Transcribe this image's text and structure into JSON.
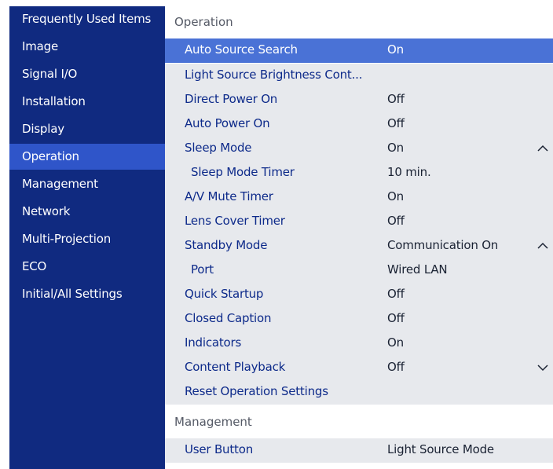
{
  "sidebar": {
    "items": [
      {
        "label": "Frequently Used Items"
      },
      {
        "label": "Image"
      },
      {
        "label": "Signal I/O"
      },
      {
        "label": "Installation"
      },
      {
        "label": "Display"
      },
      {
        "label": "Operation",
        "active": true
      },
      {
        "label": "Management"
      },
      {
        "label": "Network"
      },
      {
        "label": "Multi-Projection"
      },
      {
        "label": "ECO"
      },
      {
        "label": "Initial/All Settings"
      }
    ]
  },
  "main": {
    "section_operation": "Operation",
    "section_management": "Management",
    "rows": [
      {
        "label": "Auto Source Search",
        "value": "On",
        "selected": true
      },
      {
        "label": "Light Source Brightness Cont...",
        "value": ""
      },
      {
        "label": "Direct Power On",
        "value": "Off"
      },
      {
        "label": "Auto Power On",
        "value": "Off"
      },
      {
        "label": "Sleep Mode",
        "value": "On",
        "chevron": "chevron-up-icon"
      },
      {
        "label": "Sleep Mode Timer",
        "value": "10 min.",
        "sub": true
      },
      {
        "label": "A/V Mute Timer",
        "value": "On"
      },
      {
        "label": "Lens Cover Timer",
        "value": "Off"
      },
      {
        "label": "Standby Mode",
        "value": "Communication On",
        "chevron": "chevron-up-icon"
      },
      {
        "label": "Port",
        "value": "Wired LAN",
        "sub": true
      },
      {
        "label": "Quick Startup",
        "value": "Off"
      },
      {
        "label": "Closed Caption",
        "value": "Off"
      },
      {
        "label": "Indicators",
        "value": "On"
      },
      {
        "label": "Content Playback",
        "value": "Off",
        "chevron": "chevron-down-icon"
      },
      {
        "label": "Reset Operation Settings",
        "value": ""
      }
    ],
    "management_rows": [
      {
        "label": "User Button",
        "value": "Light Source Mode"
      }
    ]
  },
  "colors": {
    "sidebar_bg": "#102a80",
    "sidebar_active": "#2f55c9",
    "row_bg": "#e7e9ed",
    "row_selected": "#4a72d6",
    "label_text": "#0d2a8a"
  }
}
